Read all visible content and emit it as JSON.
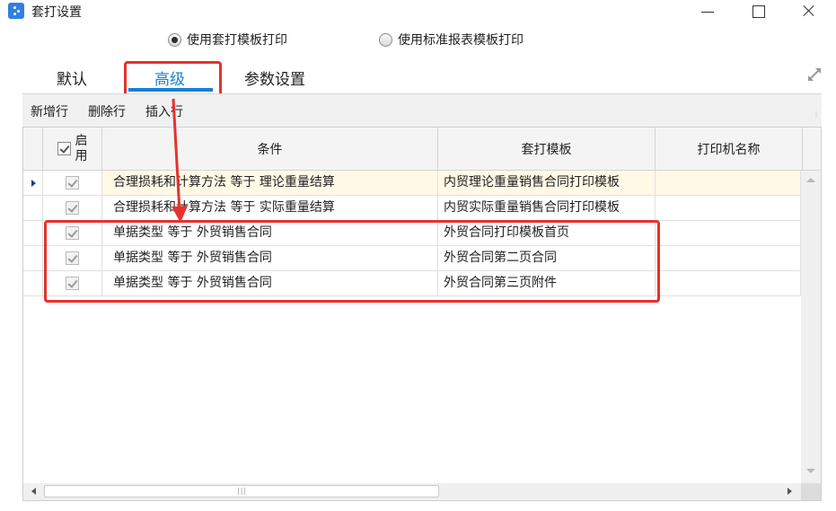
{
  "window": {
    "title": "套打设置",
    "controls": {
      "minimize": "minimize",
      "maximize": "maximize",
      "close": "close"
    }
  },
  "print_mode": {
    "options": [
      {
        "label": "使用套打模板打印",
        "selected": true
      },
      {
        "label": "使用标准报表模板打印",
        "selected": false
      }
    ]
  },
  "tabs": [
    {
      "label": "默认",
      "active": false
    },
    {
      "label": "高级",
      "active": true
    },
    {
      "label": "参数设置",
      "active": false
    }
  ],
  "toolbar": {
    "add_row": "新增行",
    "delete_row": "删除行",
    "insert_row": "插入行"
  },
  "grid": {
    "columns": {
      "enabled": "启\n用",
      "condition": "条件",
      "template": "套打模板",
      "printer": "打印机名称"
    },
    "rows": [
      {
        "enabled": true,
        "condition": "合理损耗和计算方法 等于 理论重量结算",
        "template": "内贸理论重量销售合同打印模板",
        "printer": "",
        "selected": true
      },
      {
        "enabled": true,
        "condition": "合理损耗和计算方法 等于 实际重量结算",
        "template": "内贸实际重量销售合同打印模板",
        "printer": "",
        "selected": false
      },
      {
        "enabled": true,
        "condition": "单据类型 等于 外贸销售合同",
        "template": "外贸合同打印模板首页",
        "printer": "",
        "selected": false
      },
      {
        "enabled": true,
        "condition": "单据类型 等于 外贸销售合同",
        "template": "外贸合同第二页合同",
        "printer": "",
        "selected": false
      },
      {
        "enabled": true,
        "condition": "单据类型 等于 外贸销售合同",
        "template": "外贸合同第三页附件",
        "printer": "",
        "selected": false
      }
    ]
  },
  "colors": {
    "accent": "#1a7fd8",
    "highlight": "#e5322d",
    "selected_row": "#fff9e6"
  }
}
